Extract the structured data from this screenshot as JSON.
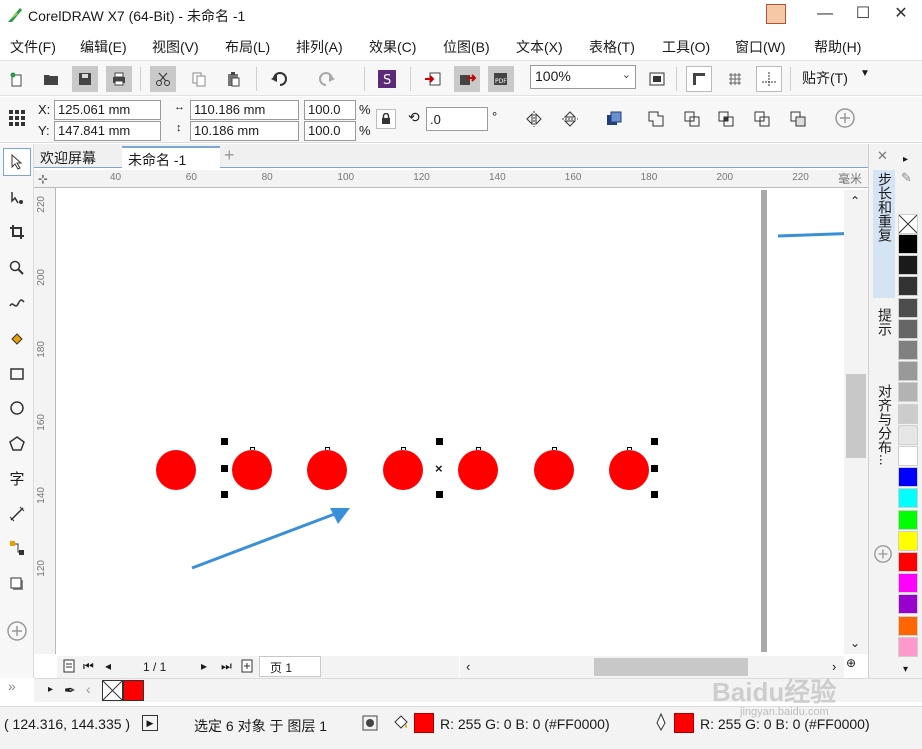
{
  "window": {
    "title": "CorelDRAW X7 (64-Bit) - 未命名 -1",
    "minimize_glyph": "—",
    "maximize_glyph": "☐",
    "close_glyph": "✕"
  },
  "menu": [
    "文件(F)",
    "编辑(E)",
    "视图(V)",
    "布局(L)",
    "排列(A)",
    "效果(C)",
    "位图(B)",
    "文本(X)",
    "表格(T)",
    "工具(O)",
    "窗口(W)",
    "帮助(H)"
  ],
  "toolbar": {
    "zoom_value": "100%",
    "snap_label": "贴齐(T)",
    "icons": [
      "new-document-icon",
      "open-folder-icon",
      "save-icon",
      "print-icon",
      "cut-icon",
      "copy-icon",
      "paste-icon",
      "undo-icon",
      "redo-icon",
      "search-content-icon",
      "import-icon",
      "export-icon",
      "publish-pdf-icon",
      "full-screen-preview-icon",
      "show-rulers-icon",
      "show-grid-icon",
      "show-guidelines-icon"
    ]
  },
  "property_bar": {
    "x_label": "X:",
    "x_value": "125.061 mm",
    "y_label": "Y:",
    "y_value": "147.841 mm",
    "width_value": "110.186 mm",
    "height_value": "10.186 mm",
    "scale_x": "100.0",
    "scale_y": "100.0",
    "percent": "%",
    "rotation_value": ".0",
    "degree": "°"
  },
  "tabs": {
    "welcome": "欢迎屏幕",
    "document": "未命名 -1",
    "add_glyph": "+"
  },
  "rulers": {
    "unit": "毫米",
    "h_ticks": [
      "40",
      "60",
      "80",
      "100",
      "120",
      "140",
      "160",
      "180",
      "200",
      "220"
    ],
    "v_ticks": [
      "220",
      "200",
      "180",
      "160",
      "140",
      "120"
    ]
  },
  "canvas": {
    "circle_count": 7,
    "fill_color": "#ff0000",
    "selected_count": 6
  },
  "page_nav": {
    "page_counter": "1 / 1",
    "page_tab": "页 1"
  },
  "dock": {
    "tabs": [
      "步长和重复",
      "提示",
      "对齐与分布..."
    ]
  },
  "palette": {
    "colors": [
      "#000000",
      "#1a1a1a",
      "#333333",
      "#4d4d4d",
      "#666666",
      "#808080",
      "#999999",
      "#b3b3b3",
      "#cccccc",
      "#e6e6e6",
      "#ffffff",
      "#0000ff",
      "#00ffff",
      "#00ff00",
      "#ffff00",
      "#ff0000",
      "#ff00ff",
      "#9900cc",
      "#ff6600",
      "#ff99cc"
    ]
  },
  "status": {
    "cursor_coords": "( 124.316, 144.335 )",
    "selection_text": "选定 6 对象 于 图层 1",
    "fill_value": "R: 255 G: 0 B: 0 (#FF0000)",
    "outline_value": "R: 255 G: 0 B: 0 (#FF0000)"
  },
  "watermark": {
    "text": "Baidu经验",
    "url": "jingyan.baidu.com"
  },
  "accent_colors": {
    "arrow": "#3a8fd9",
    "selected_border": "#7aa7d8"
  }
}
